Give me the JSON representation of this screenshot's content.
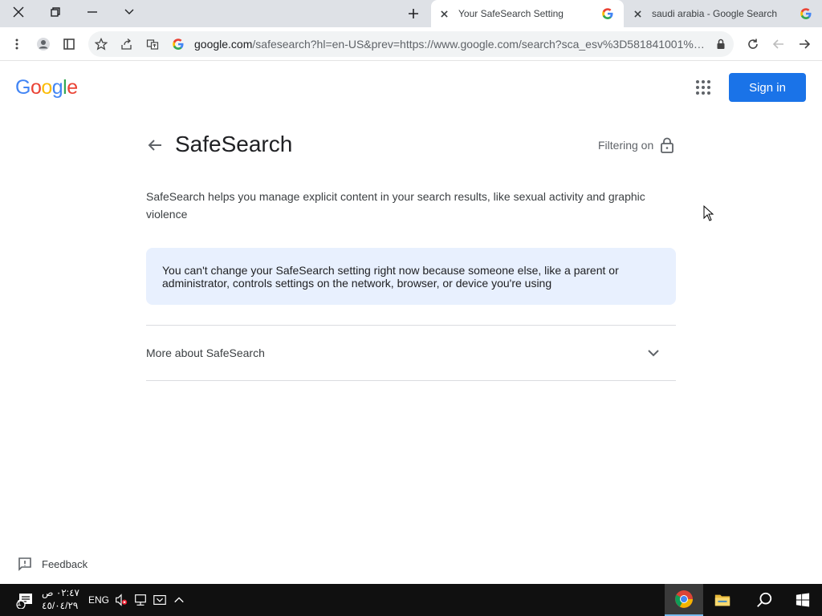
{
  "browser": {
    "tabs": [
      {
        "title": "Your SafeSearch Setting",
        "active": true
      },
      {
        "title": "saudi arabia - Google Search",
        "active": false
      }
    ],
    "omnibox": {
      "host": "google.com",
      "path": "/safesearch?hl=en-US&prev=https://www.google.com/search?sca_esv%3D581841001%26..."
    }
  },
  "page": {
    "logo_letters": [
      "G",
      "o",
      "o",
      "g",
      "l",
      "e"
    ],
    "logo_colors": [
      "#4285F4",
      "#EA4335",
      "#FBBC05",
      "#4285F4",
      "#34A853",
      "#EA4335"
    ],
    "sign_in_label": "Sign in",
    "title": "SafeSearch",
    "filter_status": "Filtering on",
    "description": "SafeSearch helps you manage explicit content in your search results, like sexual activity and graphic violence",
    "notice": "You can't change your SafeSearch setting right now because someone else, like a parent or administrator, controls settings on the network, browser, or device you're using",
    "more_label": "More about SafeSearch",
    "feedback_label": "Feedback"
  },
  "taskbar": {
    "time": "٠٢:٤٧ ص",
    "date": "٤٥/٠٤/٢٩",
    "language": "ENG",
    "notification_count": "1"
  },
  "colors": {
    "accent": "#1a73e8",
    "notice_bg": "#e8f0fe",
    "taskbar_bg": "#101010"
  }
}
